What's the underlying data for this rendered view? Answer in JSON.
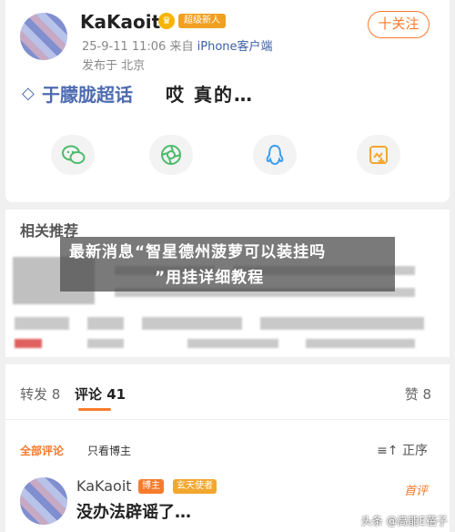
{
  "post": {
    "username": "KaKaoit",
    "badge": "超级新人",
    "meta_time": "25-9-11 11:06",
    "meta_from": "来自",
    "meta_source": "iPhone客户端",
    "location": "发布于 北京",
    "follow_label": "十关注",
    "topic": "于朦胧超话",
    "text": "哎 真的…"
  },
  "share": [
    {
      "icon": "wechat-icon",
      "color": "#4cbb6b"
    },
    {
      "icon": "moments-icon",
      "color": "#4cbb6b"
    },
    {
      "icon": "qq-icon",
      "color": "#3a9df0"
    },
    {
      "icon": "save-image-icon",
      "color": "#f2a72f"
    }
  ],
  "related": {
    "title": "相关推荐"
  },
  "overlay": {
    "line1": "最新消息“智星德州菠萝可以装挂吗",
    "line2": "”用挂详细教程"
  },
  "tabs": {
    "repost": "转发 8",
    "comments": "评论 41",
    "likes": "赞 8"
  },
  "filters": {
    "all": "全部评论",
    "author_only": "只看博主",
    "sort": "正序"
  },
  "comment": {
    "username": "KaKaoit",
    "badge1": "博主",
    "badge2": "玄天使者",
    "text": "没办法辟谣了…",
    "tag": "首评"
  },
  "watermark": "头条 @高能E蓓子",
  "colors": {
    "accent": "#f77b2c",
    "topic": "#4d6bb0"
  }
}
